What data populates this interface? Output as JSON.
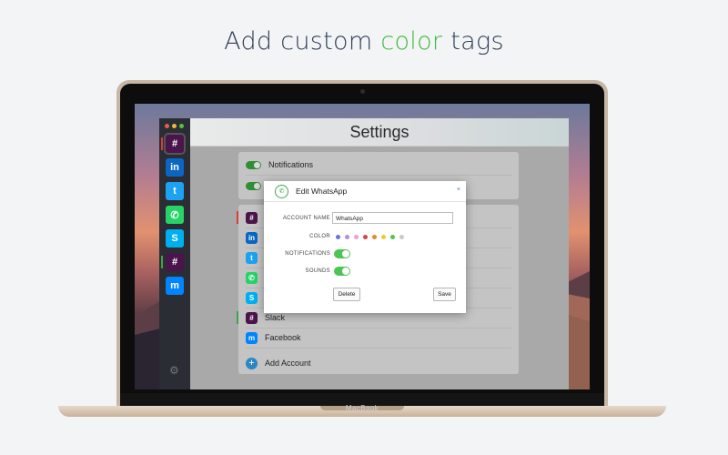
{
  "headline": {
    "prefix": "Add custom ",
    "accent": "color",
    "suffix": " tags"
  },
  "laptop": {
    "label": "MacBook"
  },
  "window": {
    "title": "Settings"
  },
  "sidebar": {
    "items": [
      {
        "name": "Slack",
        "glyph": "#",
        "color": "#4a154b",
        "marker": "#d93b3b",
        "selected": true
      },
      {
        "name": "LinkedIn",
        "glyph": "in",
        "color": "#0a66c2",
        "marker": ""
      },
      {
        "name": "Twitter",
        "glyph": "t",
        "color": "#1da1f2",
        "marker": ""
      },
      {
        "name": "WhatsApp",
        "glyph": "✆",
        "color": "#25d366",
        "marker": ""
      },
      {
        "name": "Skype",
        "glyph": "S",
        "color": "#00aff0",
        "marker": ""
      },
      {
        "name": "Slack",
        "glyph": "#",
        "color": "#4a154b",
        "marker": "#3ba34b"
      },
      {
        "name": "Messenger",
        "glyph": "m",
        "color": "#0084ff",
        "marker": ""
      }
    ]
  },
  "settings": {
    "toggles": [
      {
        "label": "Notifications",
        "on": true
      },
      {
        "label": "",
        "on": true
      }
    ],
    "accounts": [
      {
        "name": "",
        "glyph": "#",
        "color": "#4a154b",
        "marker": "#d93b3b"
      },
      {
        "name": "",
        "glyph": "in",
        "color": "#0a66c2",
        "marker": ""
      },
      {
        "name": "",
        "glyph": "t",
        "color": "#1da1f2",
        "marker": ""
      },
      {
        "name": "",
        "glyph": "✆",
        "color": "#25d366",
        "marker": ""
      },
      {
        "name": "",
        "glyph": "S",
        "color": "#00aff0",
        "marker": ""
      },
      {
        "name": "Slack",
        "glyph": "#",
        "color": "#4a154b",
        "marker": "#3ba34b"
      },
      {
        "name": "Facebook",
        "glyph": "m",
        "color": "#0084ff",
        "marker": ""
      }
    ],
    "add_account_label": "Add Account"
  },
  "dialog": {
    "title": "Edit WhatsApp",
    "close_icon": "×",
    "account_name_label": "ACCOUNT NAME",
    "account_name_value": "WhatsApp",
    "color_label": "COLOR",
    "colors": [
      "#6b73d6",
      "#b58be6",
      "#e6a2d4",
      "#d64545",
      "#e6892e",
      "#e6cf2e",
      "#55c255",
      "#c9c9c9"
    ],
    "notifications_label": "NOTIFICATIONS",
    "notifications_on": true,
    "sounds_label": "SOUNDS",
    "sounds_on": true,
    "delete_label": "Delete",
    "save_label": "Save"
  }
}
